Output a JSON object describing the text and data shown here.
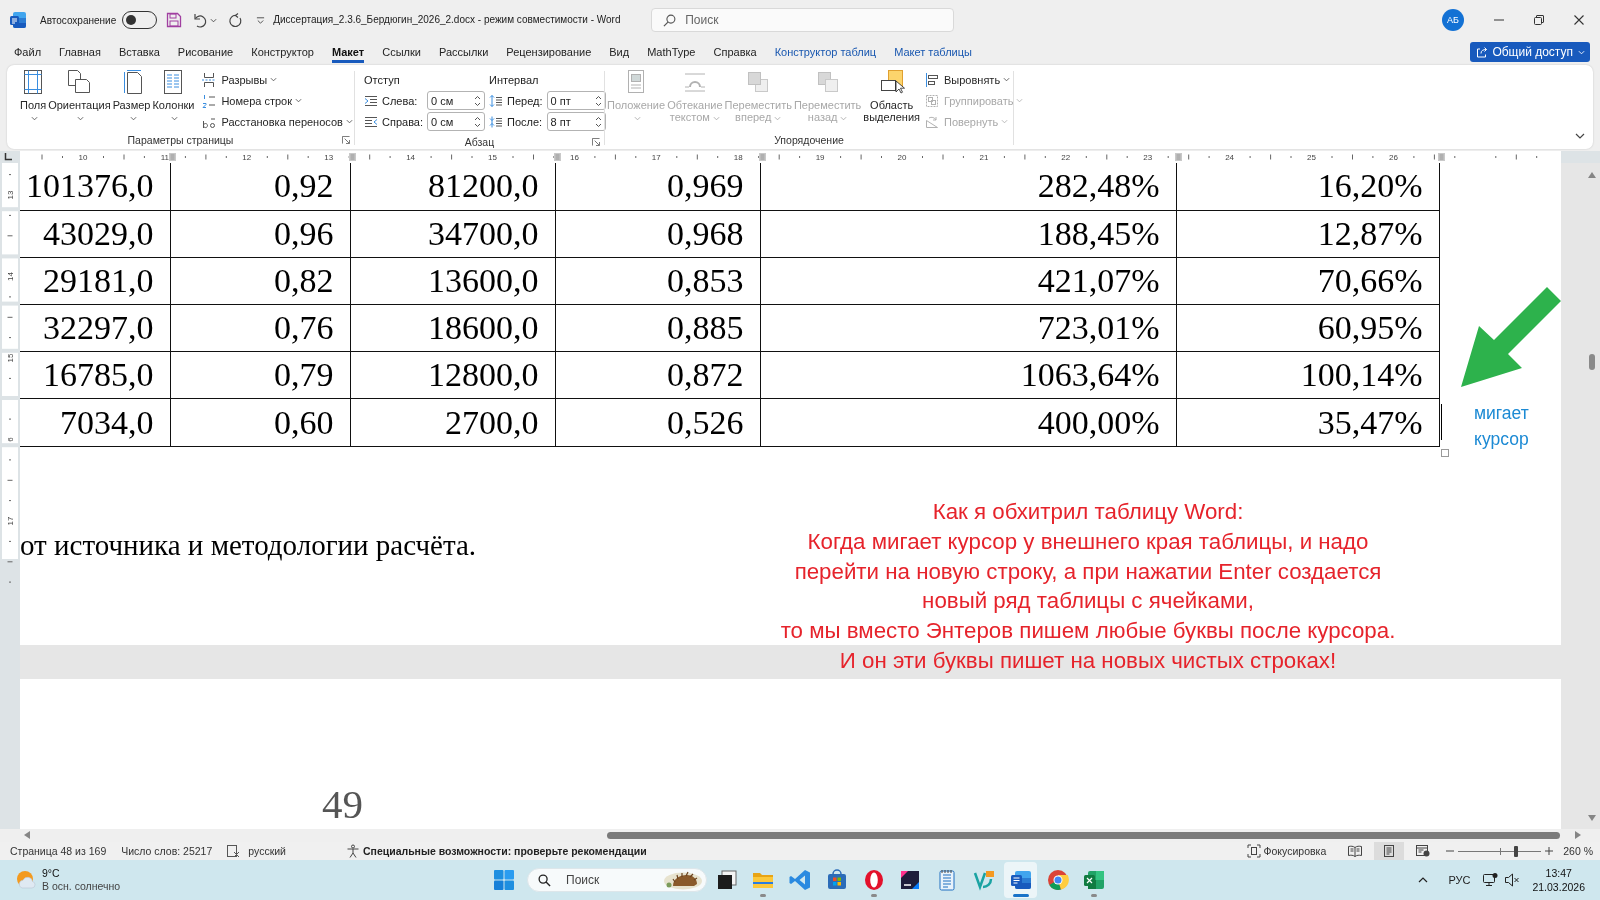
{
  "title_bar": {
    "autosave_label": "Автосохранение",
    "autosave_on": false,
    "title": "Диссертация_2.3.6_Бердюгин_2026_2.docx - режим совместимости - Word",
    "search": {
      "placeholder": "Поиск"
    },
    "avatar": "АБ"
  },
  "ribbon_tabs": [
    {
      "label": "Файл",
      "selected": false,
      "contextual": false
    },
    {
      "label": "Главная",
      "selected": false,
      "contextual": false
    },
    {
      "label": "Вставка",
      "selected": false,
      "contextual": false
    },
    {
      "label": "Рисование",
      "selected": false,
      "contextual": false
    },
    {
      "label": "Конструктор",
      "selected": false,
      "contextual": false
    },
    {
      "label": "Макет",
      "selected": true,
      "contextual": false
    },
    {
      "label": "Ссылки",
      "selected": false,
      "contextual": false
    },
    {
      "label": "Рассылки",
      "selected": false,
      "contextual": false
    },
    {
      "label": "Рецензирование",
      "selected": false,
      "contextual": false
    },
    {
      "label": "Вид",
      "selected": false,
      "contextual": false
    },
    {
      "label": "MathType",
      "selected": false,
      "contextual": false
    },
    {
      "label": "Справка",
      "selected": false,
      "contextual": false
    },
    {
      "label": "Конструктор таблиц",
      "selected": false,
      "contextual": true
    },
    {
      "label": "Макет таблицы",
      "selected": false,
      "contextual": true
    }
  ],
  "share_button": {
    "label": "Общий доступ"
  },
  "ribbon": {
    "page_setup": {
      "label": "Параметры страницы",
      "large_buttons": [
        {
          "label": "Поля",
          "dropdown": true
        },
        {
          "label": "Ориентация",
          "dropdown": true
        },
        {
          "label": "Размер",
          "dropdown": true
        },
        {
          "label": "Колонки",
          "dropdown": true
        }
      ],
      "small_buttons": [
        {
          "label": "Разрывы"
        },
        {
          "label": "Номера строк"
        },
        {
          "label": "Расстановка переносов"
        }
      ]
    },
    "paragraph": {
      "label": "Абзац",
      "indent": {
        "title": "Отступ",
        "fields": [
          {
            "label": "Слева:",
            "value": "0 см"
          },
          {
            "label": "Справа:",
            "value": "0 см"
          }
        ]
      },
      "spacing": {
        "title": "Интервал",
        "fields": [
          {
            "label": "Перед:",
            "value": "0 пт"
          },
          {
            "label": "После:",
            "value": "8 пт"
          }
        ]
      }
    },
    "arrange": {
      "label": "Упорядочение",
      "large_buttons": [
        {
          "label": "Положение",
          "dropdown": true,
          "disabled": true
        },
        {
          "label": "Обтекание текстом",
          "dropdown": true,
          "disabled": true
        },
        {
          "label": "Переместить вперед",
          "dropdown": true,
          "disabled": true
        },
        {
          "label": "Переместить назад",
          "dropdown": true,
          "disabled": true
        },
        {
          "label": "Область выделения",
          "dropdown": false,
          "disabled": false
        }
      ],
      "small_buttons": [
        {
          "label": "Выровнять",
          "disabled": false
        },
        {
          "label": "Группировать",
          "disabled": true
        },
        {
          "label": "Повернуть",
          "disabled": true
        }
      ]
    }
  },
  "ruler": {
    "horizontal": [
      "10",
      "11",
      "12",
      "13",
      "14",
      "15",
      "16",
      "17",
      "18",
      "19",
      "20",
      "21",
      "22",
      "23",
      "24",
      "25",
      "26"
    ],
    "vertical": [
      "13",
      "14",
      "15",
      "6",
      "17"
    ]
  },
  "document": {
    "table": {
      "rows": [
        [
          "101376,0",
          "0,92",
          "81200,0",
          "0,969",
          "282,48%",
          "16,20%"
        ],
        [
          "43029,0",
          "0,96",
          "34700,0",
          "0,968",
          "188,45%",
          "12,87%"
        ],
        [
          "29181,0",
          "0,82",
          "13600,0",
          "0,853",
          "421,07%",
          "70,66%"
        ],
        [
          "32297,0",
          "0,76",
          "18600,0",
          "0,885",
          "723,01%",
          "60,95%"
        ],
        [
          "16785,0",
          "0,79",
          "12800,0",
          "0,872",
          "1063,64%",
          "100,14%"
        ],
        [
          "7034,0",
          "0,60",
          "2700,0",
          "0,526",
          "400,00%",
          "35,47%"
        ]
      ]
    },
    "text": "от источника и методологии расчёта.",
    "page_number": "49"
  },
  "annotation": {
    "lines": [
      "Как я обхитрил таблицу Word:",
      "Когда мигает курсор у внешнего края таблицы, и надо",
      "перейти на новую строку, а при нажатии Enter создается",
      "новый ряд таблицы с ячейками,",
      "то мы вместо Энтеров пишем любые буквы после курсора.",
      "И он эти буквы пишет на новых чистых строках!"
    ],
    "cursor_note": "мигает курсор"
  },
  "status_bar": {
    "page": "Страница 48 из 169",
    "words": "Число слов: 25217",
    "language": "русский",
    "accessibility": "Специальные возможности: проверьте рекомендации",
    "focus": "Фокусировка",
    "views": [
      {
        "selected": false
      },
      {
        "selected": true
      },
      {
        "selected": false
      }
    ],
    "zoom": {
      "level": 0.7,
      "reading": "260 %"
    }
  },
  "taskbar": {
    "weather": {
      "temperature": "9°C",
      "condition": "В осн. солнечно"
    },
    "search": {
      "placeholder": "Поиск"
    },
    "apps": [
      {
        "running": false,
        "active": false
      },
      {
        "running": true,
        "active": false
      },
      {
        "running": false,
        "active": false
      },
      {
        "running": false,
        "active": false
      },
      {
        "running": true,
        "active": false
      },
      {
        "running": false,
        "active": false
      },
      {
        "running": false,
        "active": false
      },
      {
        "running": false,
        "active": false
      },
      {
        "running": true,
        "active": true
      },
      {
        "running": false,
        "active": false
      },
      {
        "running": true,
        "active": false
      }
    ],
    "language": "РУС",
    "time": "13:47",
    "date": "21.03.2026"
  }
}
